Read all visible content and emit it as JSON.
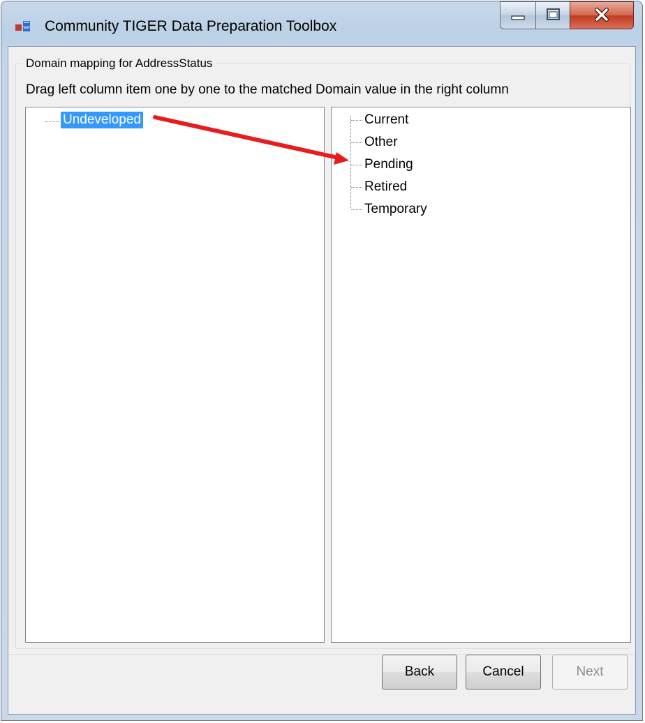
{
  "window": {
    "title": "Community TIGER Data Preparation Toolbox"
  },
  "group": {
    "legend": "Domain mapping for AddressStatus",
    "instruction": "Drag left column item one by one to the matched Domain value in the right column"
  },
  "source_tree": {
    "items": [
      {
        "label": "Undeveloped",
        "selected": true
      }
    ]
  },
  "domain_tree": {
    "items": [
      {
        "label": "Current"
      },
      {
        "label": "Other"
      },
      {
        "label": "Pending"
      },
      {
        "label": "Retired"
      },
      {
        "label": "Temporary"
      }
    ]
  },
  "buttons": {
    "back": "Back",
    "cancel": "Cancel",
    "next": "Next"
  },
  "annotation": {
    "arrow_color": "#e81c1c",
    "from": "Undeveloped",
    "to": "Pending"
  },
  "icons": {
    "app": "app-icon",
    "minimize": "minimize-icon",
    "maximize": "maximize-icon",
    "close": "close-icon"
  }
}
